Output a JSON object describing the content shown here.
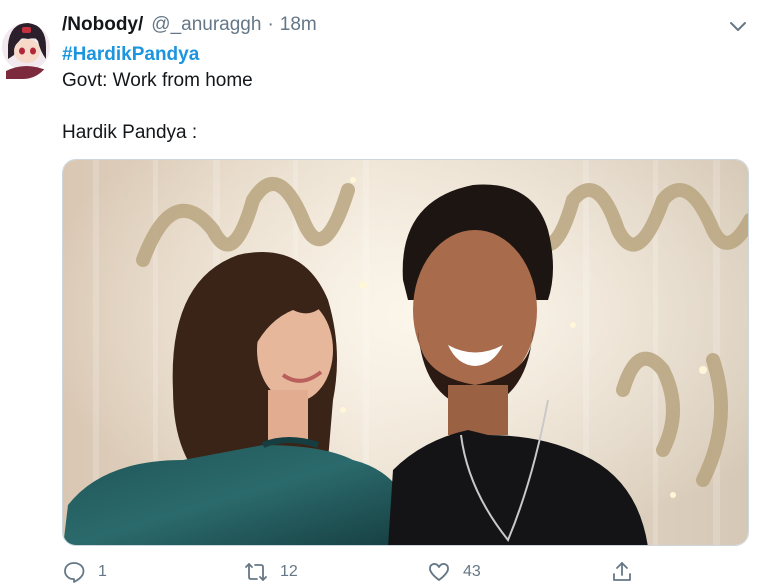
{
  "tweet": {
    "display_name": "/Nobody/",
    "handle": "@_anuraggh",
    "separator": "·",
    "time": "18m",
    "hashtag": "#HardikPandya",
    "line1": "Govt: Work from home",
    "line2": "Hardik Pandya :"
  },
  "actions": {
    "reply_count": "1",
    "retweet_count": "12",
    "like_count": "43"
  },
  "icons": {
    "caret": "chevron-down-icon",
    "reply": "comment-icon",
    "retweet": "retweet-icon",
    "like": "heart-icon",
    "share": "share-icon"
  },
  "colors": {
    "link": "#1b95e0",
    "muted": "#657786",
    "text": "#14171a"
  }
}
